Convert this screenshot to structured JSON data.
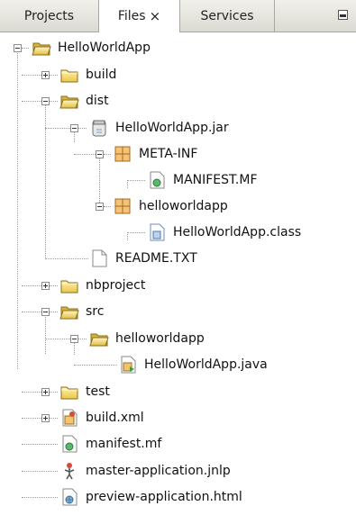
{
  "tabs": [
    {
      "label": "Projects"
    },
    {
      "label": "Files",
      "close": "×"
    },
    {
      "label": "Services"
    }
  ],
  "tree": [
    {
      "label": "HelloWorldApp",
      "icon": "open-folder-icon",
      "name": "project-root"
    },
    {
      "label": "build",
      "icon": "folder-icon",
      "name": "build-folder"
    },
    {
      "label": "dist",
      "icon": "open-folder-icon",
      "name": "dist-folder"
    },
    {
      "label": "HelloWorldApp.jar",
      "icon": "jar-icon",
      "name": "jar-file"
    },
    {
      "label": "META-INF",
      "icon": "package-icon",
      "name": "meta-inf-package"
    },
    {
      "label": "MANIFEST.MF",
      "icon": "manifest-icon",
      "name": "manifest-mf-file"
    },
    {
      "label": "helloworldapp",
      "icon": "package-icon",
      "name": "helloworldapp-package"
    },
    {
      "label": "HelloWorldApp.class",
      "icon": "class-file-icon",
      "name": "class-file"
    },
    {
      "label": "README.TXT",
      "icon": "text-file-icon",
      "name": "readme-file"
    },
    {
      "label": "nbproject",
      "icon": "folder-icon",
      "name": "nbproject-folder"
    },
    {
      "label": "src",
      "icon": "open-folder-icon",
      "name": "src-folder"
    },
    {
      "label": "helloworldapp",
      "icon": "open-folder-icon",
      "name": "src-helloworldapp-folder"
    },
    {
      "label": "HelloWorldApp.java",
      "icon": "java-file-icon",
      "name": "java-file"
    },
    {
      "label": "test",
      "icon": "folder-icon",
      "name": "test-folder"
    },
    {
      "label": "build.xml",
      "icon": "ant-build-icon",
      "name": "build-xml-file"
    },
    {
      "label": "manifest.mf",
      "icon": "manifest-icon",
      "name": "manifest-file"
    },
    {
      "label": "master-application.jnlp",
      "icon": "jnlp-icon",
      "name": "jnlp-file"
    },
    {
      "label": "preview-application.html",
      "icon": "html-file-icon",
      "name": "html-file"
    }
  ]
}
